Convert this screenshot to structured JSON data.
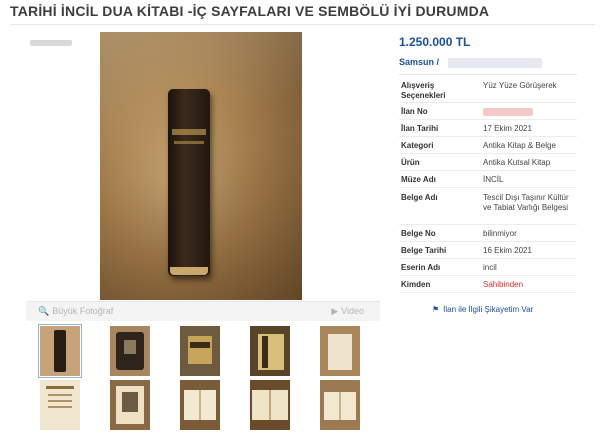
{
  "listing": {
    "title": "TARİHİ İNCİL DUA KİTABI -İÇ SAYFALARI VE SEMBÖLÜ İYİ DURUMDA",
    "price": "1.250.000 TL",
    "location": "Samsun  /"
  },
  "gallery": {
    "photo_label": "Büyük Fotoğraf",
    "video_label": "Video",
    "thumbnails": [
      {
        "name": "thumb-1",
        "selected": true
      },
      {
        "name": "thumb-2",
        "selected": false
      },
      {
        "name": "thumb-3",
        "selected": false
      },
      {
        "name": "thumb-4",
        "selected": false
      },
      {
        "name": "thumb-5",
        "selected": false
      },
      {
        "name": "thumb-6",
        "selected": false
      },
      {
        "name": "thumb-7",
        "selected": false
      },
      {
        "name": "thumb-8",
        "selected": false
      },
      {
        "name": "thumb-9",
        "selected": false
      },
      {
        "name": "thumb-10",
        "selected": false
      }
    ]
  },
  "details": [
    {
      "key": "Alışveriş Seçenekleri",
      "value": "Yüz Yüze Görüşerek"
    },
    {
      "key": "İlan No",
      "value": ""
    },
    {
      "key": "İlan Tarihi",
      "value": "17 Ekim 2021"
    },
    {
      "key": "Kategori",
      "value": "Antika Kitap & Belge"
    },
    {
      "key": "Ürün",
      "value": "Antika Kutsal Kitap"
    },
    {
      "key": "Müze Adı",
      "value": "İNCİL"
    },
    {
      "key": "Belge Adı",
      "value": "Tescil Dışı Taşınır Kültür ve Tabiat Varlığı Belgesi"
    },
    {
      "key": "Belge No",
      "value": "bilinmiyor"
    },
    {
      "key": "Belge Tarihi",
      "value": "16 Ekim 2021"
    },
    {
      "key": "Eserin Adı",
      "value": "incil"
    },
    {
      "key": "Kimden",
      "value": "Sahibinden"
    }
  ],
  "complaint_link": "İlan ile İlgili Şikayetim Var",
  "icons": {
    "zoom": "magnifier-icon",
    "video": "play-icon",
    "complaint": "flag-icon"
  },
  "colors": {
    "link_blue": "#1d4fa0",
    "owner_red": "#d9302b"
  }
}
